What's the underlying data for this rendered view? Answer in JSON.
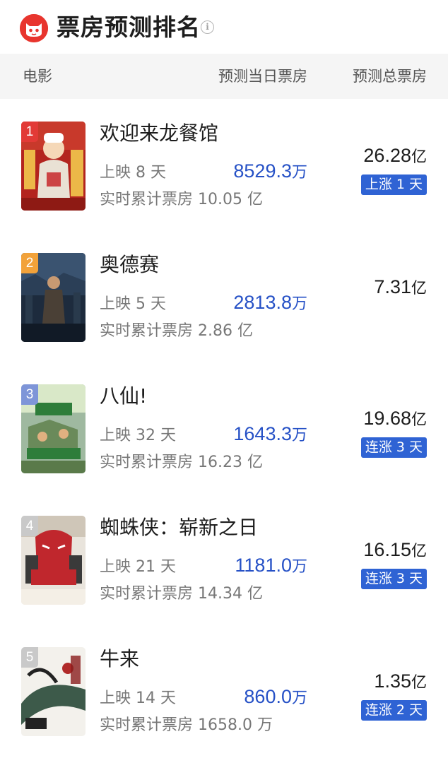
{
  "header": {
    "title": "票房预测排名",
    "info_icon": "info-icon",
    "logo_icon": "maoyan-cat-logo"
  },
  "columns": {
    "movie": "电影",
    "daily": "预测当日票房",
    "total": "预测总票房"
  },
  "colors": {
    "accent_blue": "#2651c6",
    "badge_blue": "#2f63d4",
    "rank1": "#e23a36",
    "rank2": "#f2a23a",
    "rank3": "#7e95d8",
    "rank_other": "#c9c9c9"
  },
  "movies": [
    {
      "rank": "1",
      "name": "欢迎来龙餐馆",
      "days": "上映 8 天",
      "cumulative": "实时累计票房 10.05 亿",
      "daily_value": "8529.3",
      "daily_unit": "万",
      "total_value": "26.28",
      "total_unit": "亿",
      "badge": "上涨 1 天"
    },
    {
      "rank": "2",
      "name": "奥德赛",
      "days": "上映 5 天",
      "cumulative": "实时累计票房 2.86 亿",
      "daily_value": "2813.8",
      "daily_unit": "万",
      "total_value": "7.31",
      "total_unit": "亿",
      "badge": ""
    },
    {
      "rank": "3",
      "name": "八仙!",
      "days": "上映 32 天",
      "cumulative": "实时累计票房 16.23 亿",
      "daily_value": "1643.3",
      "daily_unit": "万",
      "total_value": "19.68",
      "total_unit": "亿",
      "badge": "连涨 3 天"
    },
    {
      "rank": "4",
      "name": "蜘蛛侠：崭新之日",
      "days": "上映 21 天",
      "cumulative": "实时累计票房 14.34 亿",
      "daily_value": "1181.0",
      "daily_unit": "万",
      "total_value": "16.15",
      "total_unit": "亿",
      "badge": "连涨 3 天"
    },
    {
      "rank": "5",
      "name": "牛来",
      "days": "上映 14 天",
      "cumulative": "实时累计票房 1658.0 万",
      "daily_value": "860.0",
      "daily_unit": "万",
      "total_value": "1.35",
      "total_unit": "亿",
      "badge": "连涨 2 天"
    }
  ]
}
